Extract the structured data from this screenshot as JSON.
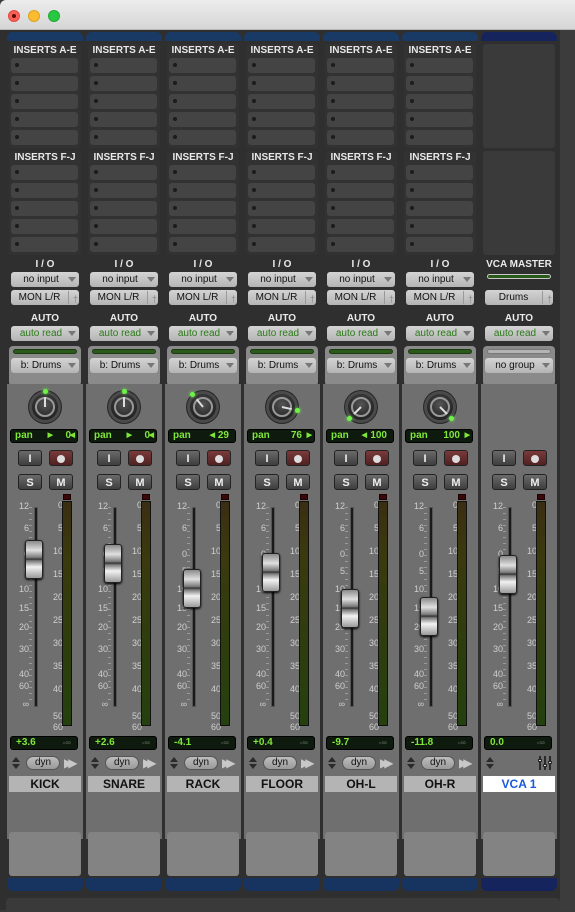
{
  "window": {
    "controls": [
      "close",
      "minimize",
      "zoom"
    ]
  },
  "labels": {
    "inserts_ae": "INSERTS A-E",
    "inserts_fj": "INSERTS F-J",
    "io": "I / O",
    "auto": "AUTO",
    "vca_master": "VCA MASTER",
    "pan": "pan",
    "input_btn": "I",
    "solo": "S",
    "mute": "M",
    "dyn": "dyn"
  },
  "fader_scale": [
    "12",
    "6",
    "0",
    "5",
    "10",
    "15",
    "20",
    "30",
    "40",
    "60",
    "∞"
  ],
  "meter_scale": [
    "0",
    "5",
    "10",
    "15",
    "20",
    "25",
    "30",
    "35",
    "40",
    "50",
    "60"
  ],
  "colors": {
    "track_color": "#1a3a66",
    "vca_color": "#16245e",
    "display_green": "#7fe63a",
    "vca_name_color": "#1a5adb"
  },
  "strips": [
    {
      "name": "KICK",
      "input": "no input",
      "output": "MON L/R",
      "automation": "auto read",
      "group": "b: Drums",
      "pan": "0",
      "pan_dir": "center",
      "volume": "+3.6",
      "peak": "-∞",
      "volume_db": 3.6
    },
    {
      "name": "SNARE",
      "input": "no input",
      "output": "MON L/R",
      "automation": "auto read",
      "group": "b: Drums",
      "pan": "0",
      "pan_dir": "center",
      "volume": "+2.6",
      "peak": "-∞",
      "volume_db": 2.6
    },
    {
      "name": "RACK",
      "input": "no input",
      "output": "MON L/R",
      "automation": "auto read",
      "group": "b: Drums",
      "pan": "29",
      "pan_dir": "left",
      "volume": "-4.1",
      "peak": "-∞",
      "volume_db": -4.1
    },
    {
      "name": "FLOOR",
      "input": "no input",
      "output": "MON L/R",
      "automation": "auto read",
      "group": "b: Drums",
      "pan": "76",
      "pan_dir": "right",
      "volume": "+0.4",
      "peak": "-∞",
      "volume_db": 0.4
    },
    {
      "name": "OH-L",
      "input": "no input",
      "output": "MON L/R",
      "automation": "auto read",
      "group": "b: Drums",
      "pan": "100",
      "pan_dir": "left",
      "volume": "-9.7",
      "peak": "-∞",
      "volume_db": -9.7
    },
    {
      "name": "OH-R",
      "input": "no input",
      "output": "MON L/R",
      "automation": "auto read",
      "group": "b: Drums",
      "pan": "100",
      "pan_dir": "right",
      "volume": "-11.8",
      "peak": "-∞",
      "volume_db": -11.8
    }
  ],
  "vca": {
    "name": "VCA 1",
    "assign": "Drums",
    "automation": "auto read",
    "group": "no group",
    "volume": "0.0",
    "peak": "-∞",
    "volume_db": 0.0
  }
}
